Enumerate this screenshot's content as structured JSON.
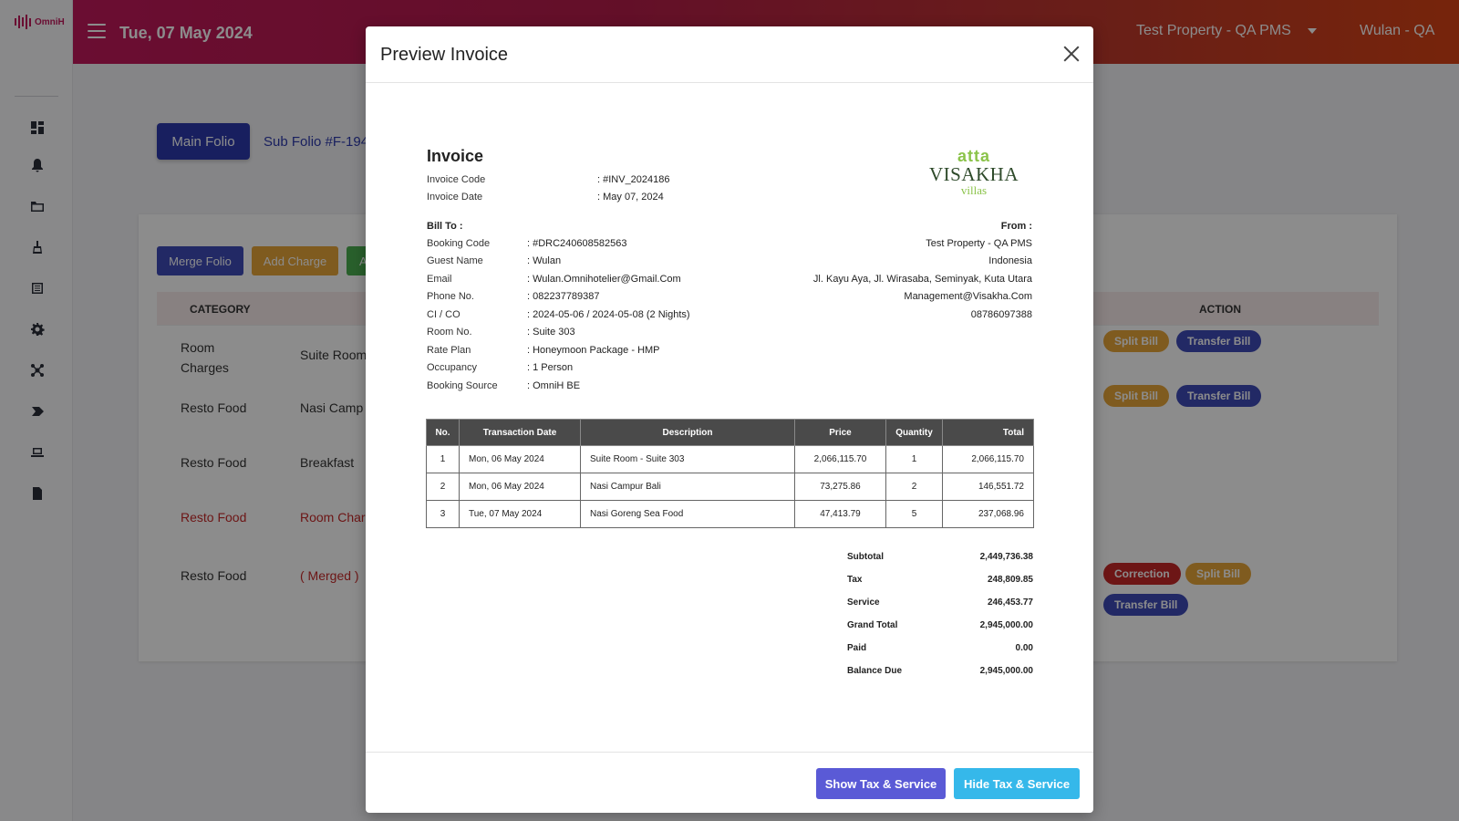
{
  "app": {
    "logo_text": "OmniH",
    "date": "Tue, 07 May 2024",
    "property": "Test Property - QA PMS",
    "user": "Wulan - QA"
  },
  "folio": {
    "main_label": "Main Folio",
    "sub_label": "Sub Folio #F-194",
    "merge_label": "Merge Folio",
    "add_charge_label": "Add Charge",
    "third_label": "A",
    "col_category": "CATEGORY",
    "col_action": "ACTION",
    "rows": [
      {
        "category": "Room Charges",
        "description": "Suite Room"
      },
      {
        "category": "Resto Food",
        "description": "Nasi Camp"
      },
      {
        "category": "Resto Food",
        "description": "Breakfast"
      },
      {
        "category": "Resto Food",
        "description": "Room Char"
      },
      {
        "category": "Resto Food",
        "description": "( Merged )"
      }
    ],
    "actions": {
      "split": "Split Bill",
      "transfer": "Transfer Bill",
      "correction": "Correction"
    }
  },
  "modal": {
    "title": "Preview Invoice",
    "show_tax_label": "Show Tax & Service",
    "hide_tax_label": "Hide Tax & Service"
  },
  "invoice": {
    "title": "Invoice",
    "code_label": "Invoice Code",
    "code_value": ": #INV_2024186",
    "date_label": "Invoice Date",
    "date_value": ": May 07, 2024",
    "logo_brand": "atta",
    "logo_name": "VISAKHA",
    "logo_sub": "villas",
    "bill_to_label": "Bill To :",
    "from_label": "From :",
    "bill_to": [
      {
        "label": "Booking Code",
        "value": ": #DRC240608582563"
      },
      {
        "label": "Guest Name",
        "value": ": Wulan"
      },
      {
        "label": "Email",
        "value": ": Wulan.Omnihotelier@Gmail.Com"
      },
      {
        "label": "Phone No.",
        "value": ": 082237789387"
      },
      {
        "label": "CI / CO",
        "value": ": 2024-05-06 / 2024-05-08 (2 Nights)"
      },
      {
        "label": "Room No.",
        "value": ": Suite 303"
      },
      {
        "label": "Rate Plan",
        "value": ": Honeymoon Package - HMP"
      },
      {
        "label": "Occupancy",
        "value": ": 1 Person"
      },
      {
        "label": "Booking Source",
        "value": ": OmniH BE"
      }
    ],
    "from": [
      "Test Property - QA PMS",
      "Indonesia",
      "Jl. Kayu Aya, Jl. Wirasaba, Seminyak, Kuta Utara",
      "Management@Visakha.Com",
      "08786097388"
    ],
    "columns": [
      "No.",
      "Transaction Date",
      "Description",
      "Price",
      "Quantity",
      "Total"
    ],
    "items": [
      {
        "no": "1",
        "date": "Mon, 06 May 2024",
        "desc": "Suite Room - Suite 303",
        "price": "2,066,115.70",
        "qty": "1",
        "total": "2,066,115.70"
      },
      {
        "no": "2",
        "date": "Mon, 06 May 2024",
        "desc": "Nasi Campur Bali",
        "price": "73,275.86",
        "qty": "2",
        "total": "146,551.72"
      },
      {
        "no": "3",
        "date": "Tue, 07 May 2024",
        "desc": "Nasi Goreng Sea Food",
        "price": "47,413.79",
        "qty": "5",
        "total": "237,068.96"
      }
    ],
    "totals": [
      {
        "label": "Subtotal",
        "value": "2,449,736.38"
      },
      {
        "label": "Tax",
        "value": "248,809.85"
      },
      {
        "label": "Service",
        "value": "246,453.77"
      },
      {
        "label": "Grand Total",
        "value": "2,945,000.00"
      },
      {
        "label": "Paid",
        "value": "0.00"
      },
      {
        "label": "Balance Due",
        "value": "2,945,000.00"
      }
    ]
  }
}
